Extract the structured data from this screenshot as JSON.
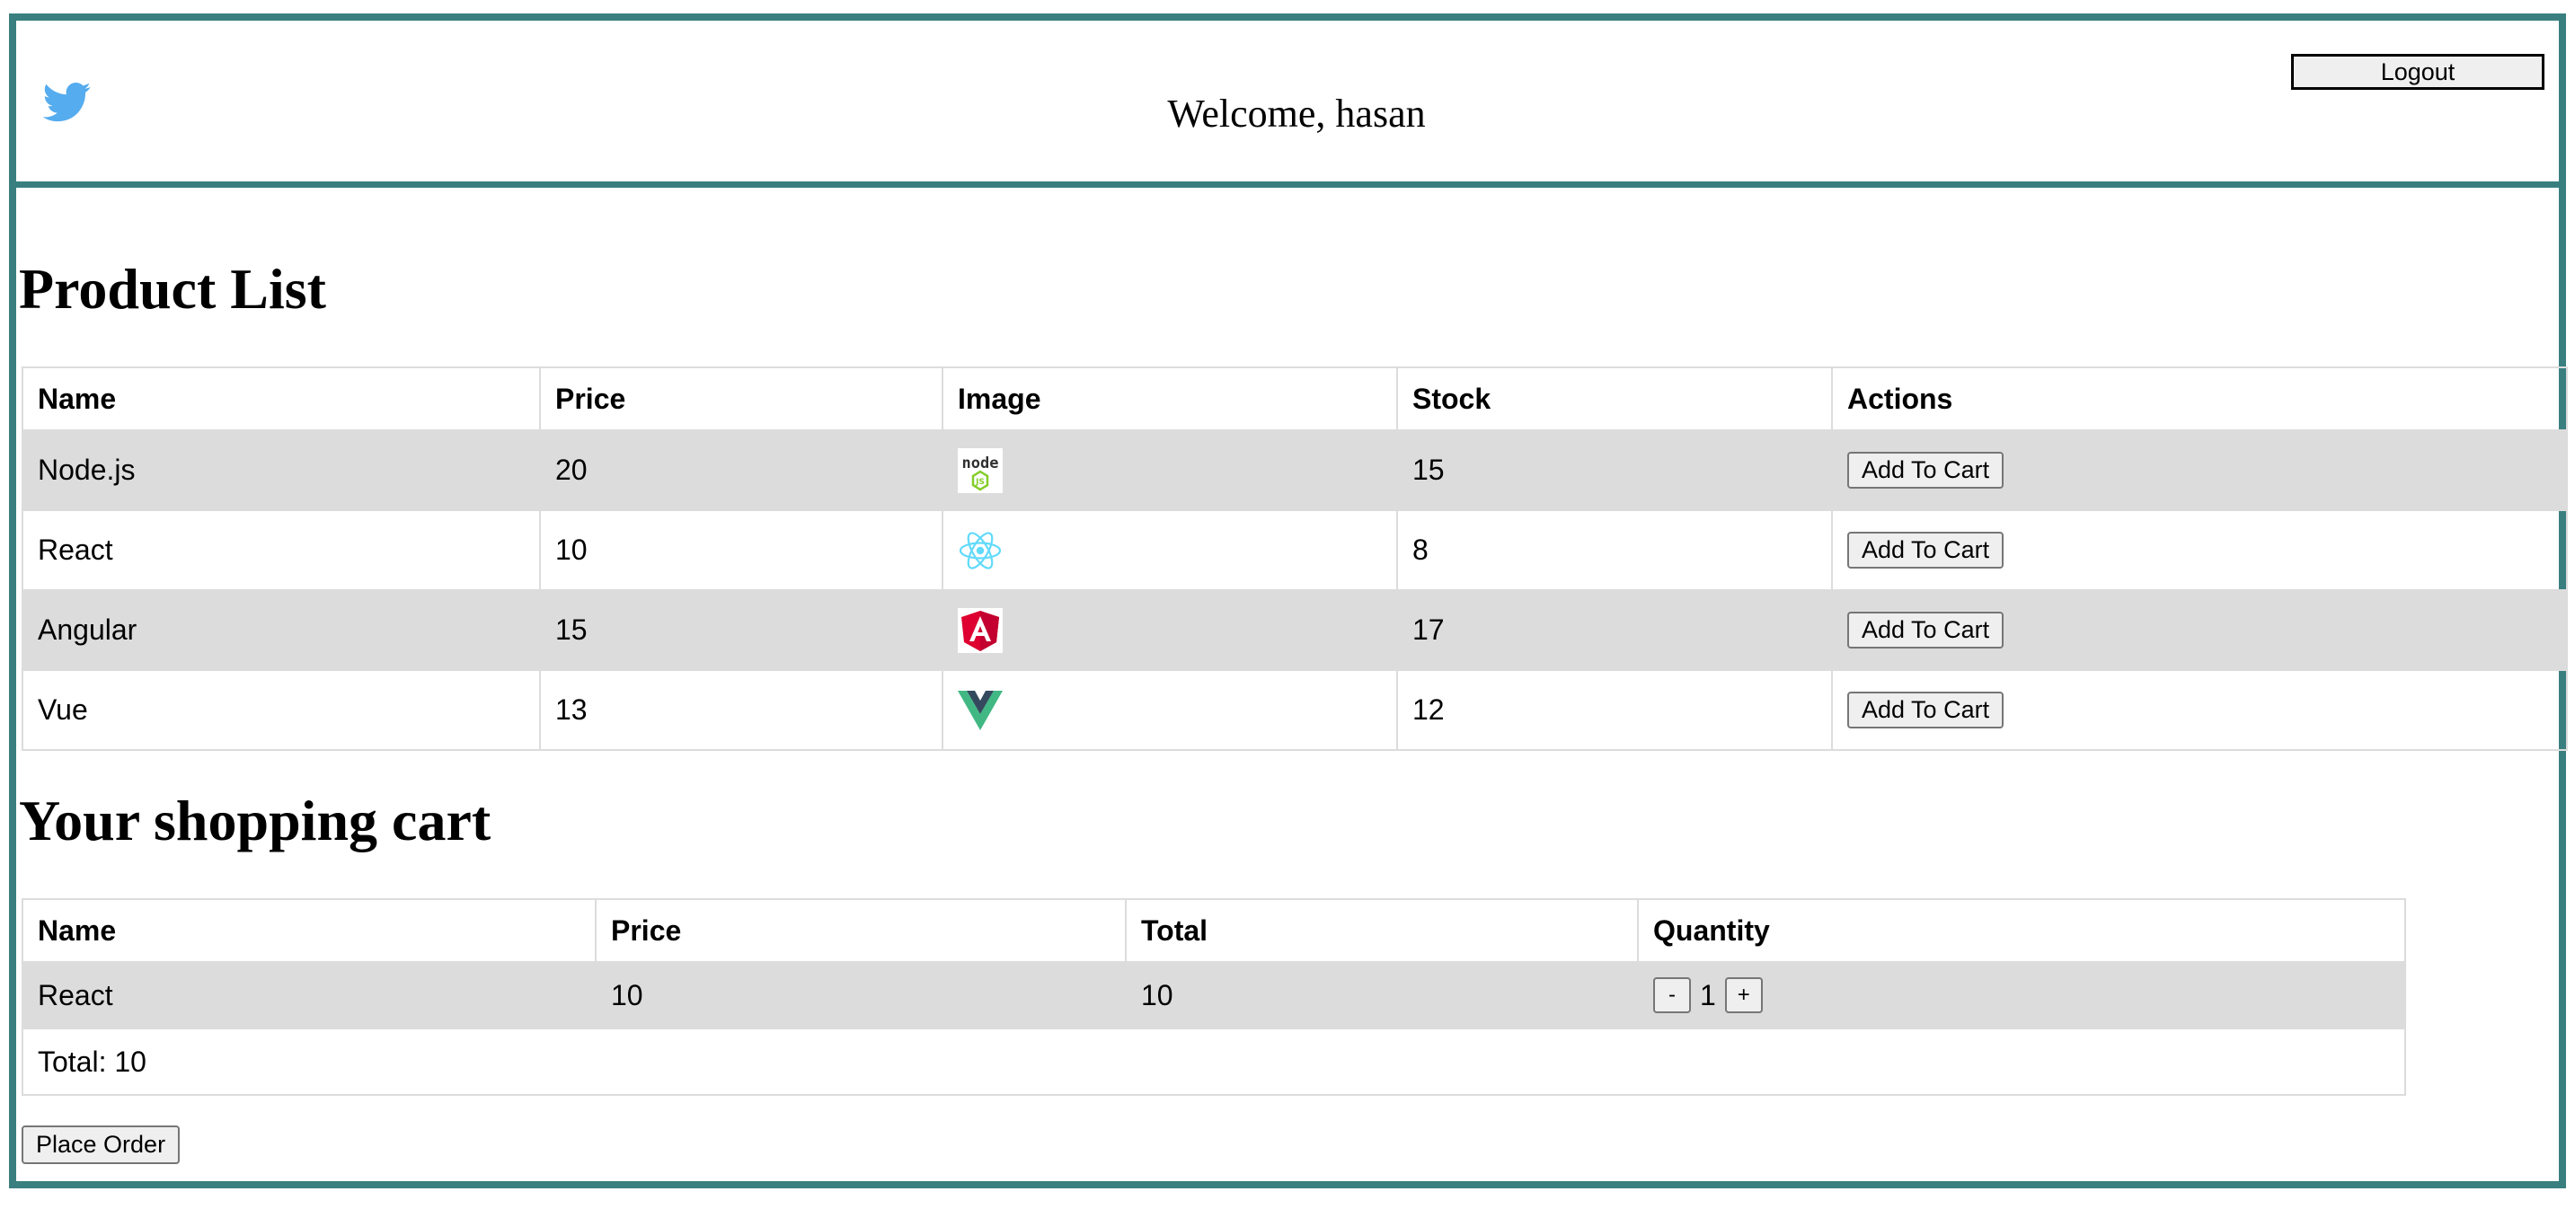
{
  "header": {
    "logo_icon": "twitter-bird-icon",
    "welcome_text": "Welcome, hasan",
    "logout_label": "Logout"
  },
  "products": {
    "title": "Product List",
    "columns": [
      "Name",
      "Price",
      "Image",
      "Stock",
      "Actions"
    ],
    "rows": [
      {
        "name": "Node.js",
        "price": "20",
        "image_icon": "nodejs-logo-icon",
        "stock": "15",
        "action_label": "Add To Cart"
      },
      {
        "name": "React",
        "price": "10",
        "image_icon": "react-logo-icon",
        "stock": "8",
        "action_label": "Add To Cart"
      },
      {
        "name": "Angular",
        "price": "15",
        "image_icon": "angular-logo-icon",
        "stock": "17",
        "action_label": "Add To Cart"
      },
      {
        "name": "Vue",
        "price": "13",
        "image_icon": "vue-logo-icon",
        "stock": "12",
        "action_label": "Add To Cart"
      }
    ]
  },
  "cart": {
    "title": "Your shopping cart",
    "columns": [
      "Name",
      "Price",
      "Total",
      "Quantity"
    ],
    "rows": [
      {
        "name": "React",
        "price": "10",
        "total": "10",
        "decrement_label": "-",
        "quantity": "1",
        "increment_label": "+"
      }
    ],
    "total_text": "Total: 10",
    "place_order_label": "Place Order"
  },
  "colors": {
    "frame_border": "#3a7f7f",
    "row_stripe": "#dcdcdc",
    "twitter_blue": "#55acee"
  }
}
